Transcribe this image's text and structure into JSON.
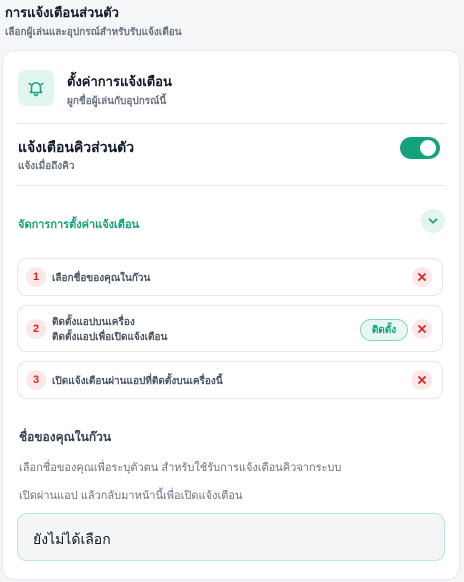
{
  "header": {
    "title": "การแจ้งเตือนส่วนตัว",
    "subtitle": "เลือกผู้เล่นและอุปกรณ์สำหรับรับแจ้งเตือน"
  },
  "settings": {
    "icon": "bell-icon",
    "title": "ตั้งค่าการแจ้งเตือน",
    "subtitle": "ผูกชื่อผู้เล่นกับอุปกรณ์นี้"
  },
  "queue_notify": {
    "title": "แจ้งเตือนคิวส่วนตัว",
    "subtitle": "แจ้งเมื่อถึงคิว",
    "enabled": true
  },
  "manage": {
    "label": "จัดการการตั้งค่าแจ้งเตือน",
    "icon": "chevron-down-icon"
  },
  "steps": [
    {
      "number": "1",
      "text": "เลือกชื่อของคุณในก๊วน"
    },
    {
      "number": "2",
      "line1": "ติดตั้งแอปบนเครื่อง",
      "line2": "ติดตั้งแอปเพื่อเปิดแจ้งเตือน",
      "action": "ติดตั้ง"
    },
    {
      "number": "3",
      "text": "เปิดแจ้งเตือนผ่านแอปที่ติดตั้งบนเครื่องนี้"
    }
  ],
  "name_section": {
    "title": "ชื่อของคุณในก๊วน",
    "desc1": "เลือกชื่อของคุณเพื่อระบุตัวตน สำหรับใช้รับการแจ้งเตือนคิวจากระบบ",
    "desc2": "เปิดผ่านแอป แล้วกลับมาหน้านี้เพื่อเปิดแจ้งเตือน",
    "select_value": "ยังไม่ได้เลือก"
  },
  "colors": {
    "accent": "#13a37a",
    "accent_soft": "#e3f5ef",
    "danger": "#dc2626",
    "danger_soft": "#fde7e7"
  }
}
